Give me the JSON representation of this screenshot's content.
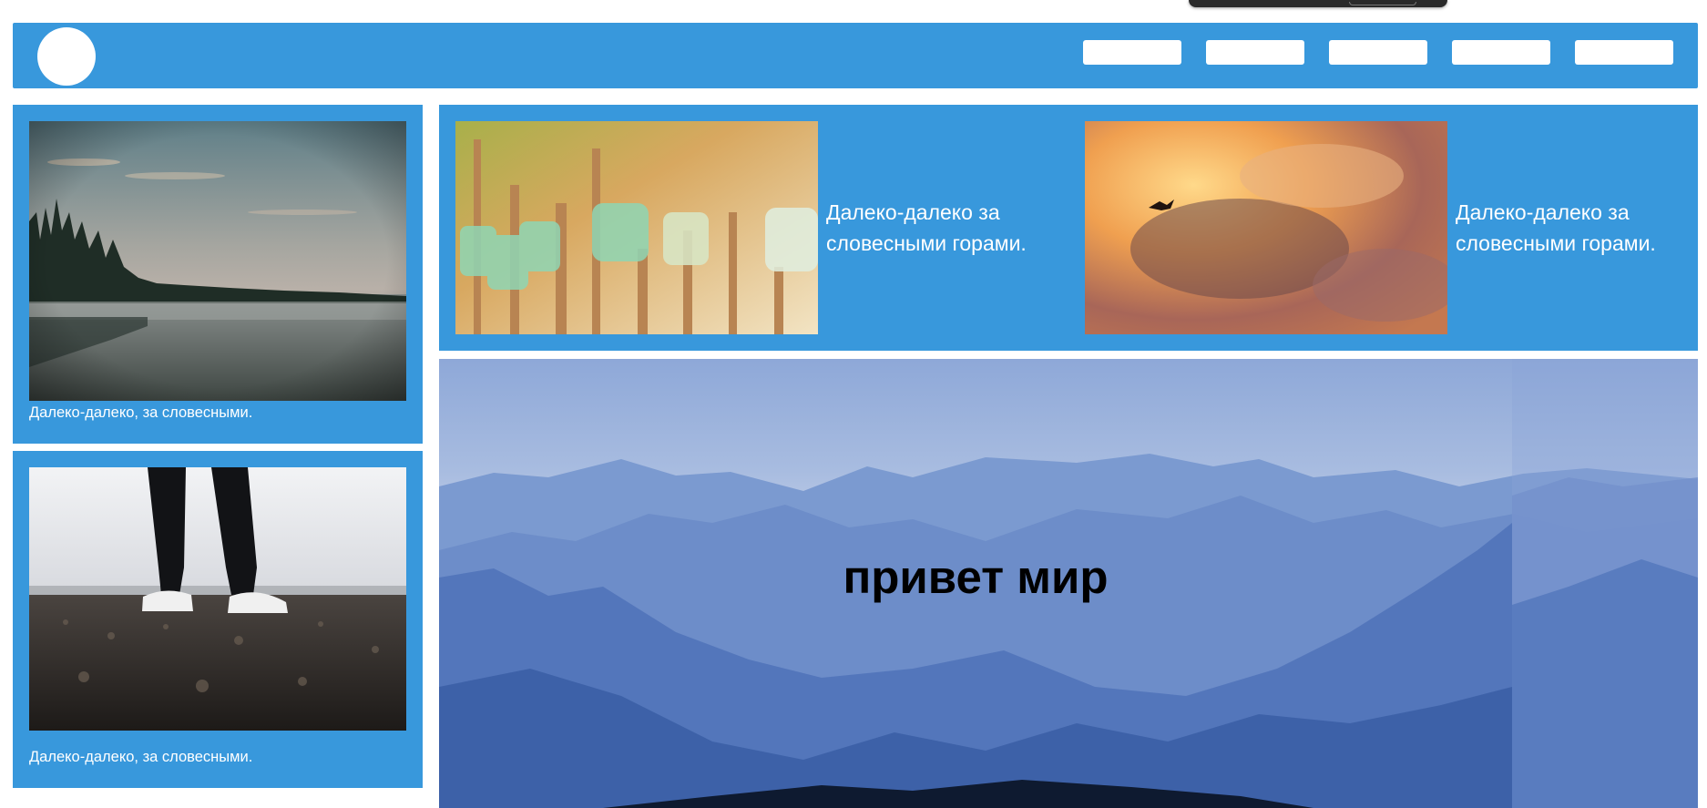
{
  "colors": {
    "accent": "#3898dc",
    "background": "#ffffff",
    "white": "#ffffff"
  },
  "header": {
    "logo": "circle-logo",
    "nav": [
      {
        "icon": "blank-button"
      },
      {
        "icon": "blank-button"
      },
      {
        "icon": "blank-button"
      },
      {
        "icon": "blank-button"
      },
      {
        "icon": "blank-button"
      }
    ]
  },
  "sidebar": {
    "cards": [
      {
        "image": "lake-forest-mist-photo",
        "caption": "Далеко-далеко, за словесными."
      },
      {
        "image": "sneakers-rocky-ground-photo",
        "caption": "Далеко-далеко, за словесными."
      }
    ]
  },
  "featured": {
    "items": [
      {
        "image": "glass-jars-on-sticks-photo",
        "text": "Далеко-далеко за словесными горами."
      },
      {
        "image": "bird-in-fiery-clouds-photo",
        "text": "Далеко-далеко за словесными горами."
      }
    ]
  },
  "hero": {
    "image": "misty-blue-mountains-photo",
    "title": "привет мир"
  }
}
